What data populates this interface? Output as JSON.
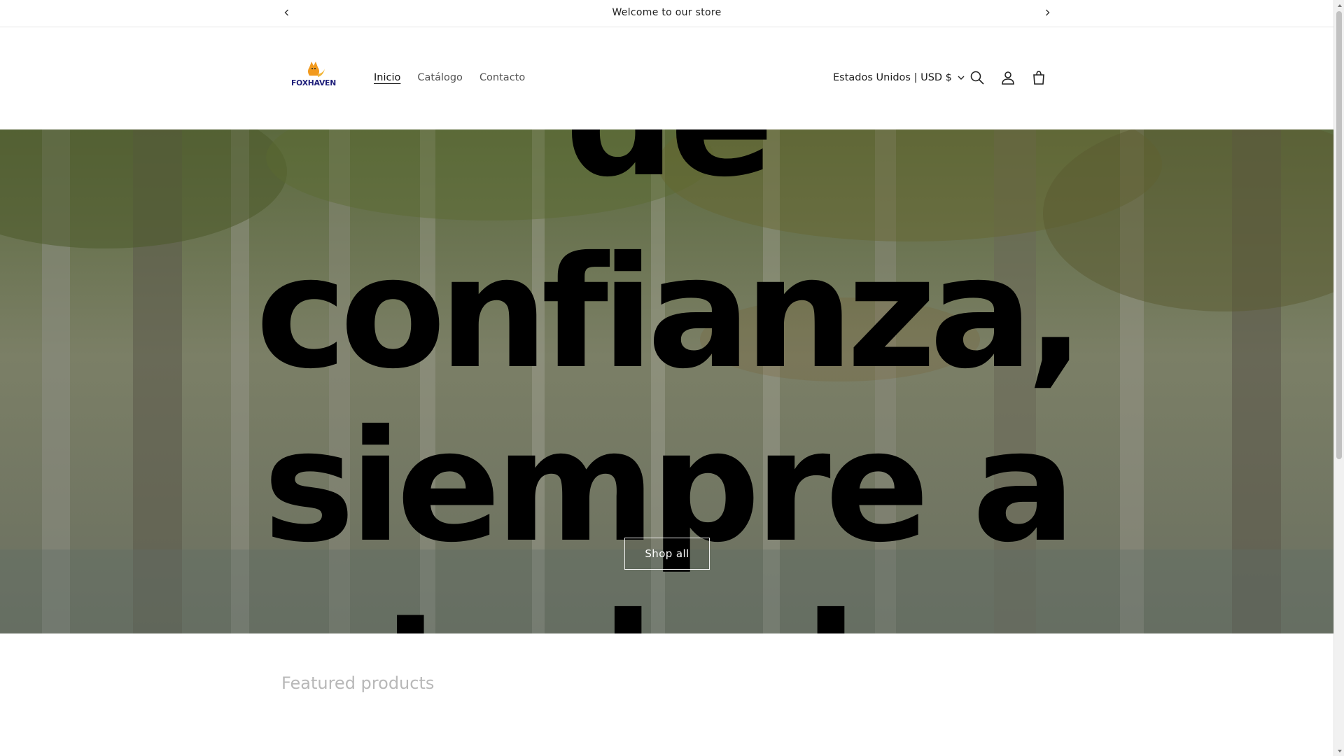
{
  "announcement": {
    "text": "Welcome to our store",
    "prev_icon": "chevron-left-icon",
    "next_icon": "chevron-right-icon"
  },
  "header": {
    "logo_text": "FOXHAVEN",
    "nav": [
      {
        "label": "Inicio",
        "active": true
      },
      {
        "label": "Catálogo",
        "active": false
      },
      {
        "label": "Contacto",
        "active": false
      }
    ],
    "country_selector": "Estados Unidos | USD $",
    "icons": [
      "search-icon",
      "account-icon",
      "cart-icon"
    ]
  },
  "hero": {
    "lines": [
      "de",
      "confianza,",
      "siempre a",
      "tu lado"
    ],
    "button_label": "Shop all"
  },
  "featured": {
    "title": "Featured products"
  },
  "colors": {
    "accent_text": "#121212",
    "muted_text": "#b8b8b8",
    "hero_overlay": "#6a7059"
  }
}
